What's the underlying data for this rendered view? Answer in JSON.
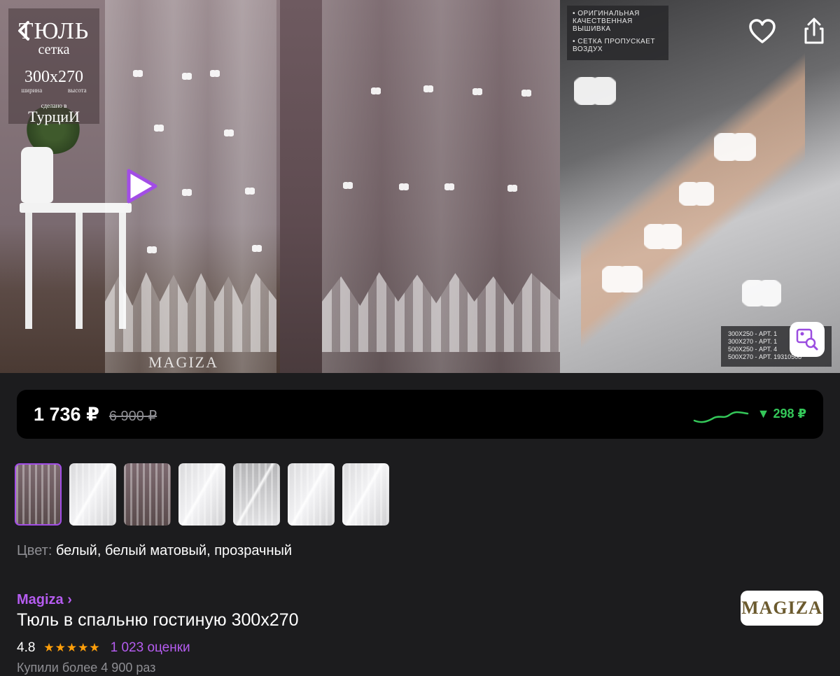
{
  "gallery": {
    "panel1": {
      "brand_title": "ТЮЛЬ",
      "brand_subtitle": "сетка",
      "size": "300x270",
      "dim_width_label": "ширина",
      "dim_height_label": "высота",
      "made_in": "сделано в",
      "country": "ТурциИ",
      "watermark": "MAGIZA"
    },
    "panel3": {
      "feature_1": "• ОРИГИНАЛЬНАЯ КАЧЕСТВЕННАЯ ВЫШИВКА",
      "feature_2": "• СЕТКА ПРОПУСКАЕТ ВОЗДУХ",
      "sizes": [
        "300X250 - АРТ. 1",
        "300X270 - АРТ. 1",
        "500X250 - АРТ. 4",
        "500X270 - АРТ. 19310508"
      ]
    },
    "icons": {
      "back": "back-icon",
      "play": "play-icon",
      "favorite": "heart-icon",
      "share": "share-icon",
      "visual_search": "image-search-icon"
    }
  },
  "price": {
    "current": "1 736 ₽",
    "old": "6 900 ₽",
    "drop": "▼ 298 ₽",
    "drop_color": "#34c759"
  },
  "thumbnails": [
    {
      "style": "dark",
      "selected": true
    },
    {
      "style": "light",
      "selected": false
    },
    {
      "style": "dark",
      "selected": false
    },
    {
      "style": "light",
      "selected": false
    },
    {
      "style": "gray",
      "selected": false
    },
    {
      "style": "light",
      "selected": false
    },
    {
      "style": "light",
      "selected": false
    }
  ],
  "details": {
    "color_label": "Цвет:",
    "color_value": "белый, белый матовый, прозрачный",
    "seller": "Magiza ›",
    "title": "Тюль в спальню гостиную 300х270",
    "rating": "4.8",
    "stars": "★★★★★",
    "reviews": "1 023 оценки",
    "bought": "Купили более 4 900 раз",
    "seller_logo": "MAGIZA"
  },
  "colors": {
    "accent": "#b55cf0",
    "selected_border": "#a24de6",
    "star": "#ff9f0a",
    "background": "#1c1c1e"
  }
}
